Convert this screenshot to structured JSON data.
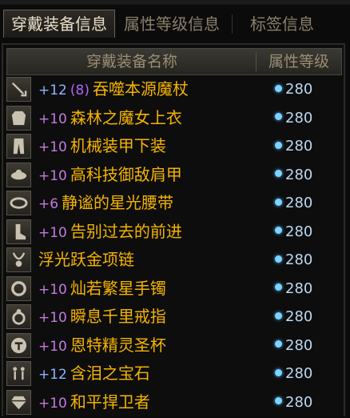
{
  "tabs": [
    {
      "label": "穿戴装备信息"
    },
    {
      "label": "属性等级信息"
    },
    {
      "label": "标签信息"
    }
  ],
  "table": {
    "col_name": "穿戴装备名称",
    "col_level": "属性等级"
  },
  "rows": [
    {
      "plus": "+12",
      "tag": "(8)",
      "name": "吞噬本源魔杖",
      "level": "280",
      "icon": "wand-icon"
    },
    {
      "plus": "+10",
      "tag": "",
      "name": "森林之魔女上衣",
      "level": "280",
      "icon": "robe-icon"
    },
    {
      "plus": "+10",
      "tag": "",
      "name": "机械装甲下装",
      "level": "280",
      "icon": "pants-icon"
    },
    {
      "plus": "+10",
      "tag": "",
      "name": "高科技御敌肩甲",
      "level": "280",
      "icon": "shoulder-icon"
    },
    {
      "plus": "+6",
      "tag": "",
      "name": "静谧的星光腰带",
      "level": "280",
      "icon": "belt-icon"
    },
    {
      "plus": "+10",
      "tag": "",
      "name": "告别过去的前进",
      "level": "280",
      "icon": "boots-icon"
    },
    {
      "plus": "",
      "tag": "",
      "name": "浮光跃金项链",
      "level": "280",
      "icon": "necklace-icon"
    },
    {
      "plus": "+10",
      "tag": "",
      "name": "灿若繁星手镯",
      "level": "280",
      "icon": "bracelet-icon"
    },
    {
      "plus": "+10",
      "tag": "",
      "name": "瞬息千里戒指",
      "level": "280",
      "icon": "ring-icon"
    },
    {
      "plus": "+10",
      "tag": "",
      "name": "恩特精灵圣杯",
      "level": "280",
      "icon": "grail-icon"
    },
    {
      "plus": "+12",
      "tag": "",
      "name": "含泪之宝石",
      "level": "280",
      "icon": "earring-icon"
    },
    {
      "plus": "+10",
      "tag": "",
      "name": "和平捍卫者",
      "level": "280",
      "icon": "gem-icon"
    }
  ]
}
